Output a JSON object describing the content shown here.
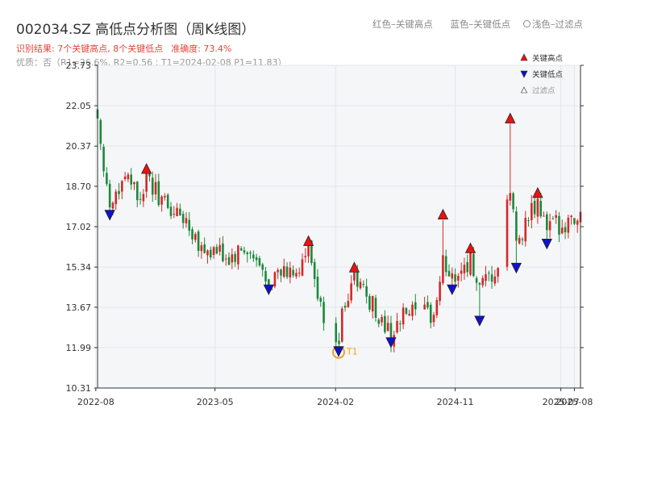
{
  "header": {
    "title": "002034.SZ 高低点分析图（周K线图）",
    "result": "识别结果: 7个关键高点, 8个关键低点",
    "accuracy": "准确度: 73.4%",
    "quality": "优质：否（R1=26.6%, R2=0.56 ; T1=2024-02-08 P1=11.83）"
  },
  "top_legend": {
    "red": "红色–关键高点",
    "blue": "蓝色–关键低点",
    "filtered": "浅色–过滤点"
  },
  "colors": {
    "up": "#d62728",
    "down": "#1a8a3a",
    "high": "#ee1111",
    "low": "#1111cc",
    "t1": "#f0a030"
  },
  "chart_data": {
    "type": "candlestick",
    "title": "002034.SZ 高低点分析图（周K线图）",
    "ylim": [
      10.31,
      23.73
    ],
    "yticks": [
      "23.73",
      "22.05",
      "20.37",
      "18.70",
      "17.02",
      "15.34",
      "13.67",
      "11.99",
      "10.31"
    ],
    "xticks": [
      {
        "date": "2022-08",
        "label": "2022-08"
      },
      {
        "date": "2023-05",
        "label": "2023-05"
      },
      {
        "date": "2024-02",
        "label": "2024-02"
      },
      {
        "date": "2024-11",
        "label": "2024-11"
      },
      {
        "date": "2025-07",
        "label": "2025-07"
      },
      {
        "date": "2025-08",
        "label": "2025-08"
      }
    ],
    "date_range": [
      "2022-08-05",
      "2025-08-15"
    ],
    "key_highs": [
      {
        "date": "2022-11-25",
        "price": 19.2
      },
      {
        "date": "2023-12-01",
        "price": 16.2
      },
      {
        "date": "2024-03-15",
        "price": 15.1
      },
      {
        "date": "2024-10-04",
        "price": 17.3
      },
      {
        "date": "2024-12-06",
        "price": 15.9
      },
      {
        "date": "2025-03-07",
        "price": 21.3
      },
      {
        "date": "2025-05-09",
        "price": 18.2
      }
    ],
    "key_lows": [
      {
        "date": "2022-09-02",
        "price": 17.5
      },
      {
        "date": "2023-09-01",
        "price": 14.4
      },
      {
        "date": "2024-02-08",
        "price": 11.83,
        "label": "T1"
      },
      {
        "date": "2024-06-07",
        "price": 12.2
      },
      {
        "date": "2024-10-25",
        "price": 14.4
      },
      {
        "date": "2024-12-27",
        "price": 13.1
      },
      {
        "date": "2025-03-21",
        "price": 15.3
      },
      {
        "date": "2025-05-30",
        "price": 16.3
      }
    ],
    "legend": [
      {
        "name": "关键高点"
      },
      {
        "name": "关键低点"
      },
      {
        "name": "过滤点"
      }
    ]
  }
}
